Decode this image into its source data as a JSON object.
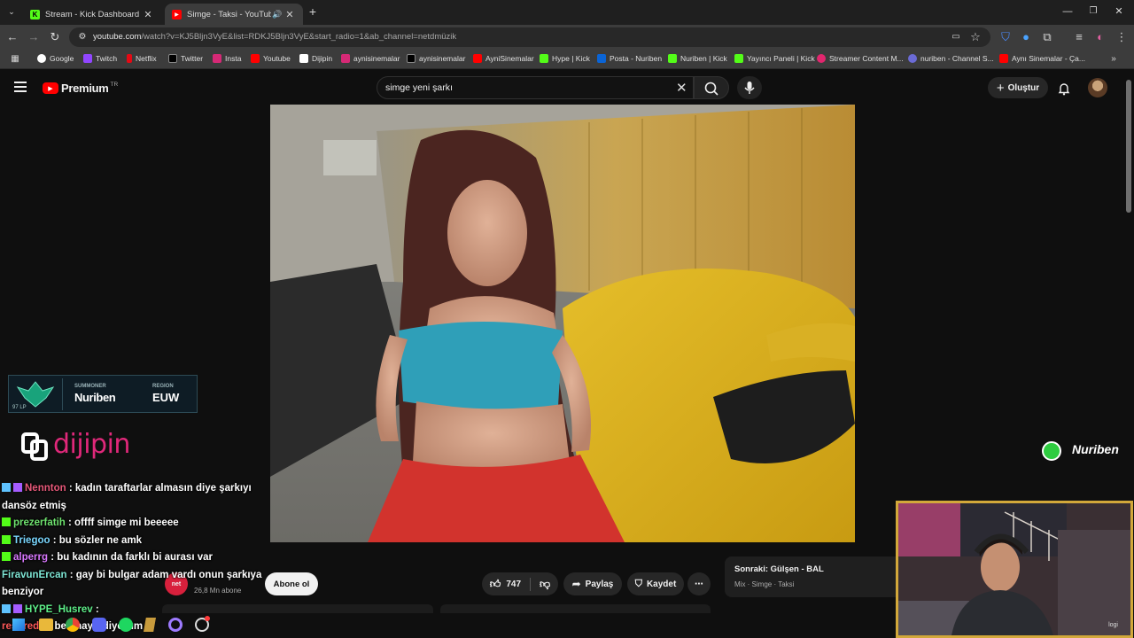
{
  "browser": {
    "tabs": [
      {
        "title": "Stream - Kick Dashboard",
        "favicon": "kick-icon",
        "active": false
      },
      {
        "title": "Simge - Taksi - YouTube",
        "favicon": "youtube-icon",
        "active": true
      }
    ],
    "url_host": "youtube.com",
    "url_path": "/watch?v=KJ5Bljn3VyE&list=RDKJ5Bljn3VyE&start_radio=1&ab_channel=netdmüzik",
    "bookmarks": [
      "Google",
      "Twitch",
      "Netflix",
      "Twitter",
      "Insta",
      "Youtube",
      "Dijipin",
      "aynisinemalar",
      "aynisinemalar",
      "AyniSinemalar",
      "Hype | Kick",
      "Posta - Nuriben",
      "Nuriben | Kick",
      "Yayıncı Paneli | Kick",
      "Streamer Content M...",
      "nuriben - Channel S...",
      "Aynı Sinemalar - Ça..."
    ]
  },
  "youtube": {
    "logo_text": "Premium",
    "logo_region": "TR",
    "search_value": "simge yeni şarkı",
    "create_label": "Oluştur",
    "channel_subs": "26,8 Mn abone",
    "subscribe_label": "Abone ol",
    "like_count": "747",
    "share_label": "Paylaş",
    "save_label": "Kaydet",
    "up_next_title": "Sonraki: Gülşen - BAL",
    "up_next_sub": "Mix · Simge · Taksi"
  },
  "overlay": {
    "summoner_label": "SUMMONER",
    "summoner_name": "Nuriben",
    "region_label": "REGION",
    "region_value": "EUW",
    "lp": "97 LP",
    "sponsor": "dijipin",
    "streamer_tag": "Nuriben",
    "webcam_label": "logi"
  },
  "chat": [
    {
      "user": "Nennton",
      "color": "#e8597a",
      "text": ": kadın taraftarlar almasın diye şarkıyı dansöz etmiş"
    },
    {
      "user": "prezerfatih",
      "color": "#6fe36f",
      "text": ": offff simge mi beeeee"
    },
    {
      "user": "Triegoo",
      "color": "#7ad7ff",
      "text": ": bu sözler ne amk"
    },
    {
      "user": "alperrg",
      "color": "#d978ff",
      "text": ": bu kadının da farklı bi aurası var"
    },
    {
      "user": "FiravunErcan",
      "color": "#7ee6d5",
      "text": ": gay bi bulgar adam vardı onun şarkıya benziyor"
    },
    {
      "user": "HYPE_Husrev",
      "color": "#5ff08a",
      "text": ":"
    },
    {
      "user": "resoredo",
      "color": "#ff5a5a",
      "text": ": ben hayır diyorum"
    }
  ]
}
